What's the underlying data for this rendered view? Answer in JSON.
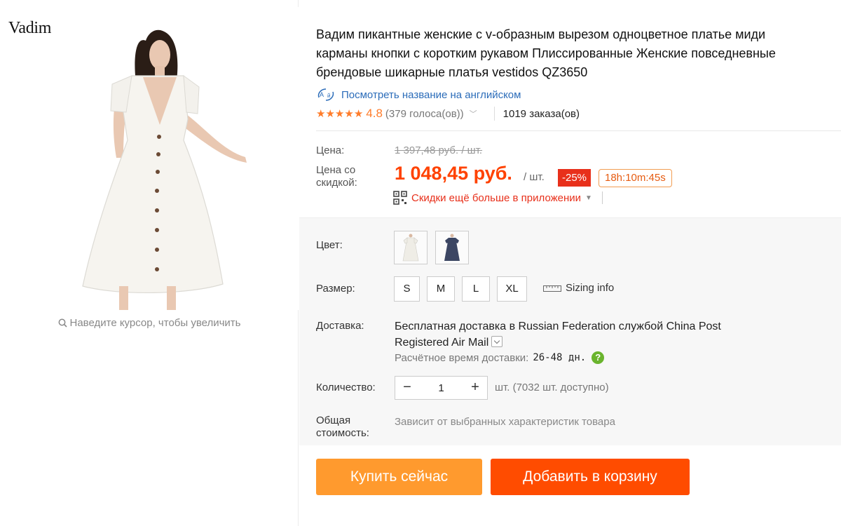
{
  "brand": {
    "name": "Vadim"
  },
  "gallery": {
    "zoom_hint": "Наведите курсор, чтобы увеличить"
  },
  "product": {
    "title": "Вадим пикантные женские с v-образным вырезом одноцветное платье миди карманы кнопки с коротким рукавом Плиссированные Женские повседневные брендовые шикарные платья vestidos QZ3650",
    "translate_link": "Посмотреть название на английском",
    "rating": "4.8",
    "stars": 5,
    "votes": "(379 голоса(ов))",
    "orders": "1019 заказа(ов)"
  },
  "price": {
    "label": "Цена:",
    "old": "1 397,48 руб. / шт.",
    "discount_label": "Цена со скидкой:",
    "new": "1 048,45 руб.",
    "unit": "/ шт.",
    "discount": "-25%",
    "timer": "18h:10m:45s",
    "app_promo": "Скидки ещё больше в приложении"
  },
  "options": {
    "color_label": "Цвет:",
    "colors": [
      "white-dress",
      "navy-dress"
    ],
    "size_label": "Размер:",
    "sizes": [
      "S",
      "M",
      "L",
      "XL"
    ],
    "sizing_info": "Sizing info",
    "shipping_label": "Доставка:",
    "shipping_prefix": "Бесплатная доставка в ",
    "shipping_location": "Russian Federation",
    "shipping_mid": " службой ",
    "shipping_carrier": "China Post Registered Air Mail",
    "delivery_time_label": "Расчётное время доставки:",
    "delivery_time_value": "26-48 дн.",
    "quantity_label": "Количество:",
    "quantity_value": "1",
    "quantity_minus": "−",
    "quantity_plus": "+",
    "quantity_available": "шт. (7032 шт. доступно)",
    "total_label": "Общая стоимость:",
    "total_note": "Зависит от выбранных характеристик товара"
  },
  "actions": {
    "buy_now": "Купить сейчас",
    "add_to_cart": "Добавить в корзину"
  },
  "colors": {
    "accent_price": "#ff4200",
    "rating_star": "#ff7c2a",
    "link": "#2b6cb9",
    "buy_button": "#ff9a2e",
    "cart_button": "#ff4c00",
    "discount_badge": "#e8301b"
  }
}
